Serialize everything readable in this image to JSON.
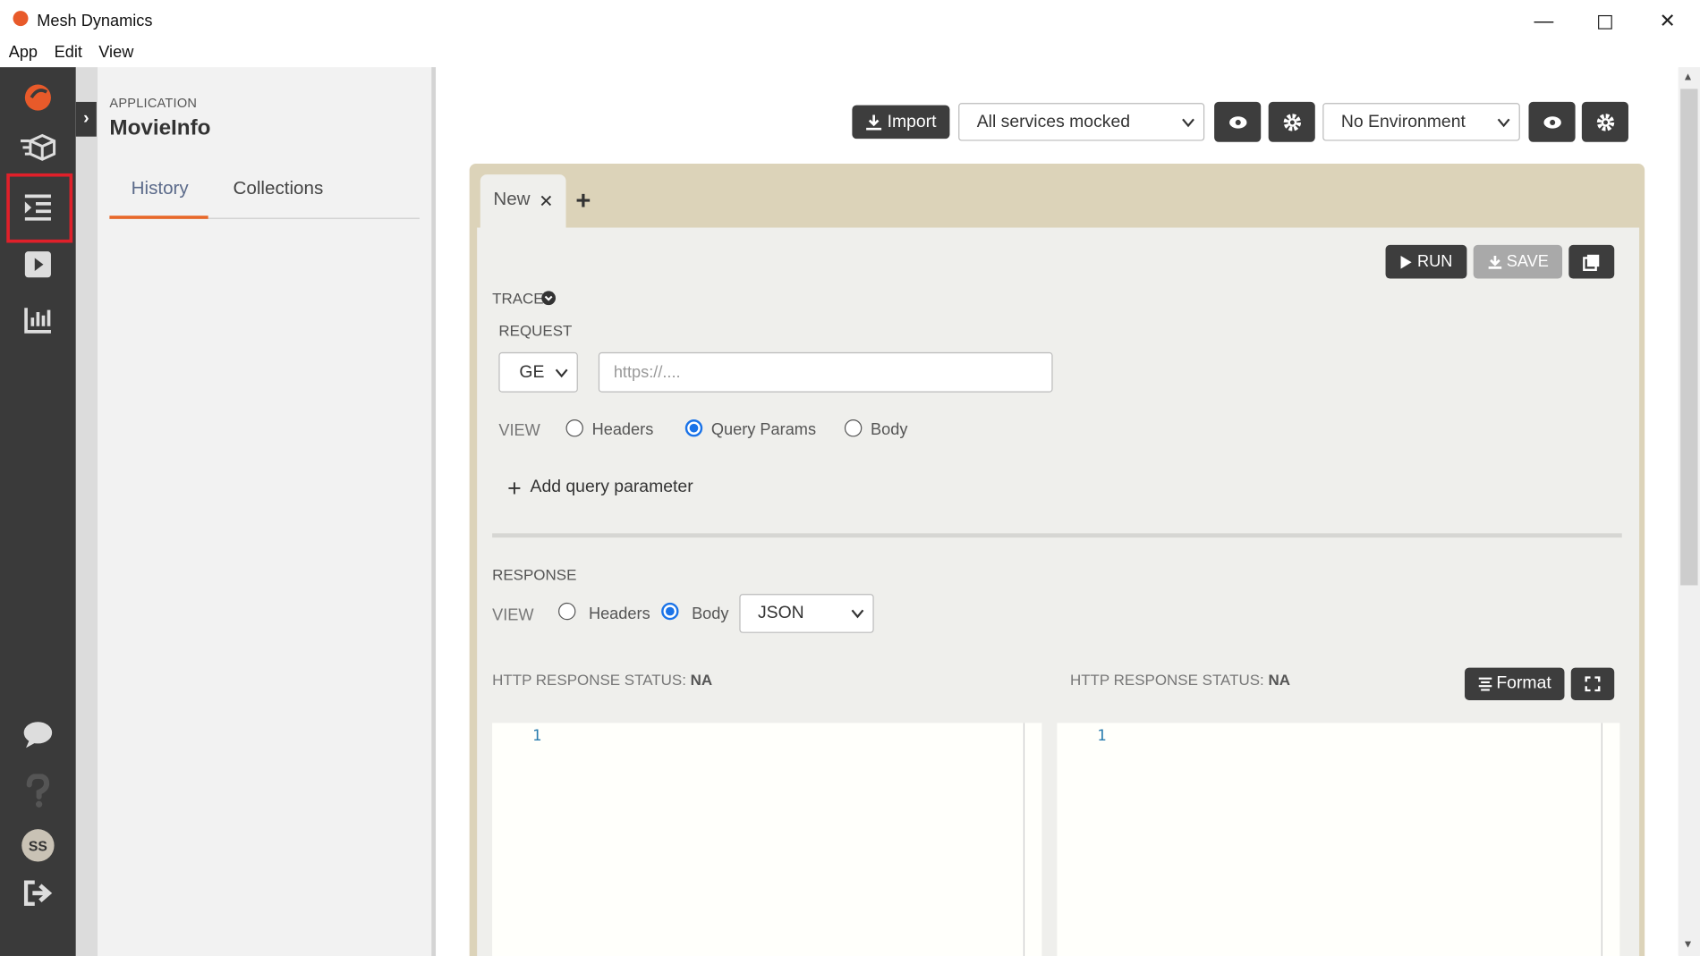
{
  "window": {
    "title": "Mesh Dynamics",
    "minimize": "—",
    "close": "✕"
  },
  "menu": {
    "items": [
      "App",
      "Edit",
      "View"
    ]
  },
  "rail": {
    "avatar_initials": "SS"
  },
  "sidepanel": {
    "app_label": "APPLICATION",
    "app_name": "MovieInfo",
    "tabs": [
      {
        "label": "History",
        "active": true
      },
      {
        "label": "Collections",
        "active": false
      }
    ]
  },
  "toolbar": {
    "import_label": "Import",
    "services_select": "All services mocked",
    "environment_select": "No Environment"
  },
  "request_tabs": {
    "tabs": [
      {
        "label": "New"
      }
    ]
  },
  "actions": {
    "run_label": "RUN",
    "save_label": "SAVE"
  },
  "request": {
    "trace_label": "TRACE",
    "section_label": "REQUEST",
    "method": "GE",
    "url_placeholder": "https://....",
    "view_label": "VIEW",
    "view_options": [
      {
        "label": "Headers",
        "selected": false
      },
      {
        "label": "Query Params",
        "selected": true
      },
      {
        "label": "Body",
        "selected": false
      }
    ],
    "add_param_label": "Add query parameter"
  },
  "response": {
    "section_label": "RESPONSE",
    "view_label": "VIEW",
    "view_options": [
      {
        "label": "Headers",
        "selected": false
      },
      {
        "label": "Body",
        "selected": true
      }
    ],
    "format_select": "JSON",
    "status_label_left": "HTTP RESPONSE STATUS:",
    "status_value_left": "NA",
    "status_label_right": "HTTP RESPONSE STATUS:",
    "status_value_right": "NA",
    "format_button": "Format",
    "left_editor_line": "1",
    "right_editor_line": "1"
  },
  "colors": {
    "rail": "#3a3a3a",
    "accent": "#e8682a",
    "card": "#dcd3b9",
    "highlight": "#e0202a",
    "radio": "#1a73e8"
  }
}
